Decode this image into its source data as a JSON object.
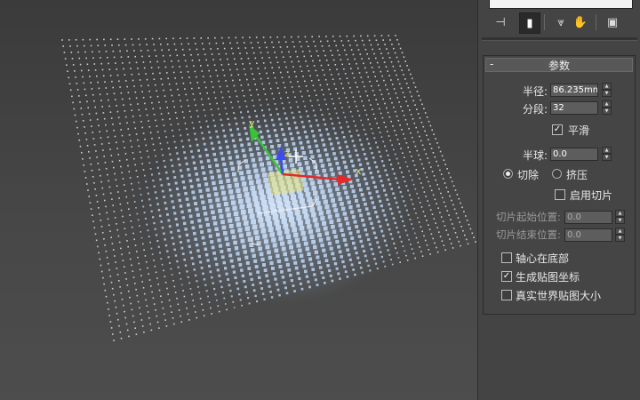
{
  "viewport": {
    "axes": {
      "x": "x",
      "y": "y",
      "z": "z"
    }
  },
  "command_panel": {
    "tabs": [
      {
        "icon": "create-icon",
        "glyph": "⊣"
      },
      {
        "icon": "modify-icon",
        "glyph": "▮"
      },
      {
        "icon": "hierarchy-icon",
        "glyph": "⩔"
      },
      {
        "icon": "motion-icon",
        "glyph": "✋"
      },
      {
        "icon": "display-icon",
        "glyph": "▣"
      }
    ],
    "rollout": {
      "toggle": "-",
      "title": "参数",
      "radius_label": "半径:",
      "radius_value": "86.235mm",
      "segments_label": "分段:",
      "segments_value": "32",
      "smooth_label": "平滑",
      "smooth_checked": true,
      "hemisphere_label": "半球:",
      "hemisphere_value": "0.0",
      "chop_label": "切除",
      "squash_label": "挤压",
      "slice_on_label": "启用切片",
      "slice_from_label": "切片起始位置:",
      "slice_from_value": "0.0",
      "slice_to_label": "切片结束位置:",
      "slice_to_value": "0.0",
      "base_to_pivot_label": "轴心在底部",
      "gen_mapping_label": "生成贴图坐标",
      "real_world_label": "真实世界贴图大小"
    }
  }
}
